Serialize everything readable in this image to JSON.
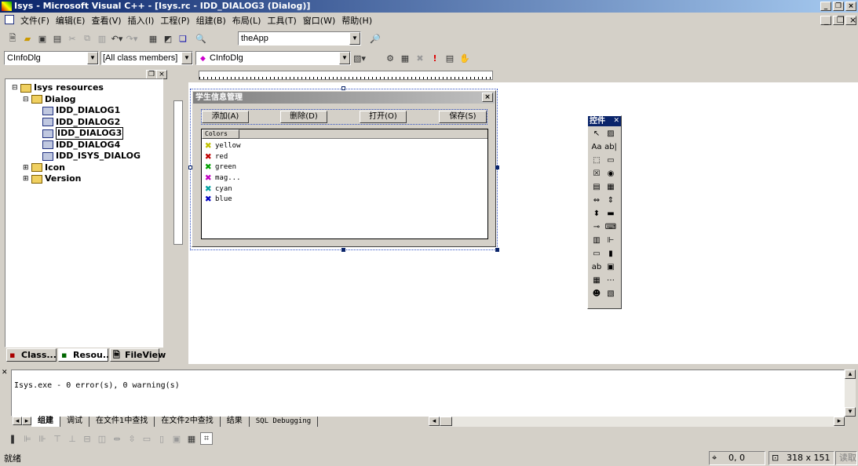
{
  "window": {
    "title": "Isys - Microsoft Visual C++ - [Isys.rc - IDD_DIALOG3 (Dialog)]"
  },
  "menu": [
    "文件(F)",
    "编辑(E)",
    "查看(V)",
    "插入(I)",
    "工程(P)",
    "组建(B)",
    "布局(L)",
    "工具(T)",
    "窗口(W)",
    "帮助(H)"
  ],
  "toolbar": {
    "search_combo": "theApp"
  },
  "wizardbar": {
    "class": "CInfoDlg",
    "filter": "[All class members]",
    "member": "CInfoDlg"
  },
  "workspace": {
    "tree": [
      {
        "label": "Isys resources",
        "level": 0,
        "type": "folder"
      },
      {
        "label": "Dialog",
        "level": 1,
        "type": "folder"
      },
      {
        "label": "IDD_DIALOG1",
        "level": 2,
        "type": "dialog"
      },
      {
        "label": "IDD_DIALOG2",
        "level": 2,
        "type": "dialog"
      },
      {
        "label": "IDD_DIALOG3",
        "level": 2,
        "type": "dialog",
        "selected": true
      },
      {
        "label": "IDD_DIALOG4",
        "level": 2,
        "type": "dialog"
      },
      {
        "label": "IDD_ISYS_DIALOG",
        "level": 2,
        "type": "dialog"
      },
      {
        "label": "Icon",
        "level": 1,
        "type": "folder"
      },
      {
        "label": "Version",
        "level": 1,
        "type": "folder"
      }
    ],
    "tabs": [
      "Class...",
      "Resou...",
      "FileView"
    ]
  },
  "dialog": {
    "title": "学生信息管理",
    "buttons": [
      "添加(A)",
      "删除(D)",
      "打开(O)",
      "保存(S)"
    ],
    "list_header": "Colors",
    "items": [
      {
        "label": "yellow",
        "color": "#c0c000"
      },
      {
        "label": "red",
        "color": "#c00000"
      },
      {
        "label": "green",
        "color": "#00a000"
      },
      {
        "label": "mag...",
        "color": "#c000c0"
      },
      {
        "label": "cyan",
        "color": "#00a0a0"
      },
      {
        "label": "blue",
        "color": "#0000c0"
      }
    ]
  },
  "controls": {
    "title": "控件"
  },
  "output": {
    "text": "Isys.exe - 0 error(s), 0 warning(s)",
    "tabs": [
      "组建",
      "调试",
      "在文件1中查找",
      "在文件2中查找",
      "结果",
      "SQL Debugging"
    ]
  },
  "status": {
    "text": "就绪",
    "position": "0, 0",
    "size": "318 x 151",
    "mode": "读取"
  }
}
